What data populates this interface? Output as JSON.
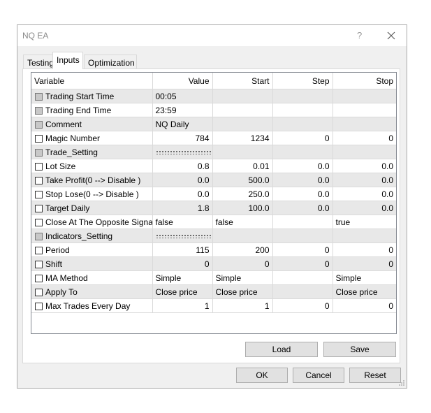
{
  "window": {
    "title": "NQ EA",
    "help": "?"
  },
  "tabs": [
    {
      "label": "Testing"
    },
    {
      "label": "Inputs"
    },
    {
      "label": "Optimization"
    }
  ],
  "columns": {
    "variable": "Variable",
    "value": "Value",
    "start": "Start",
    "step": "Step",
    "stop": "Stop"
  },
  "rows": [
    {
      "name": "Trading Start Time",
      "value": "00:05",
      "start": "",
      "step": "",
      "stop": ""
    },
    {
      "name": "Trading End Time",
      "value": "23:59",
      "start": "",
      "step": "",
      "stop": ""
    },
    {
      "name": "Comment",
      "value": "NQ Daily",
      "start": "",
      "step": "",
      "stop": ""
    },
    {
      "name": "Magic Number",
      "value": "784",
      "start": "1234",
      "step": "0",
      "stop": "0"
    },
    {
      "name": "Trade_Setting",
      "value": "",
      "start": "",
      "step": "",
      "stop": ""
    },
    {
      "name": "Lot Size",
      "value": "0.8",
      "start": "0.01",
      "step": "0.0",
      "stop": "0.0"
    },
    {
      "name": "Take Profit(0 --> Disable )",
      "value": "0.0",
      "start": "500.0",
      "step": "0.0",
      "stop": "0.0"
    },
    {
      "name": "Stop Lose(0 --> Disable )",
      "value": "0.0",
      "start": "250.0",
      "step": "0.0",
      "stop": "0.0"
    },
    {
      "name": "Target Daily",
      "value": "1.8",
      "start": "100.0",
      "step": "0.0",
      "stop": "0.0"
    },
    {
      "name": "Close At The Opposite Signal",
      "value": "false",
      "start": "false",
      "step": "",
      "stop": "true"
    },
    {
      "name": "Indicators_Setting",
      "value": "",
      "start": "",
      "step": "",
      "stop": ""
    },
    {
      "name": "Period",
      "value": "115",
      "start": "200",
      "step": "0",
      "stop": "0"
    },
    {
      "name": "Shift",
      "value": "0",
      "start": "0",
      "step": "0",
      "stop": "0"
    },
    {
      "name": "MA Method",
      "value": "Simple",
      "start": "Simple",
      "step": "",
      "stop": "Simple"
    },
    {
      "name": "Apply To",
      "value": "Close price",
      "start": "Close price",
      "step": "",
      "stop": "Close price"
    },
    {
      "name": "Max Trades Every Day",
      "value": "1",
      "start": "1",
      "step": "0",
      "stop": "0"
    }
  ],
  "buttons": {
    "load": "Load",
    "save": "Save",
    "ok": "OK",
    "cancel": "Cancel",
    "reset": "Reset"
  },
  "icons": {
    "close": "close-icon",
    "grip": "resize-grip-icon"
  }
}
